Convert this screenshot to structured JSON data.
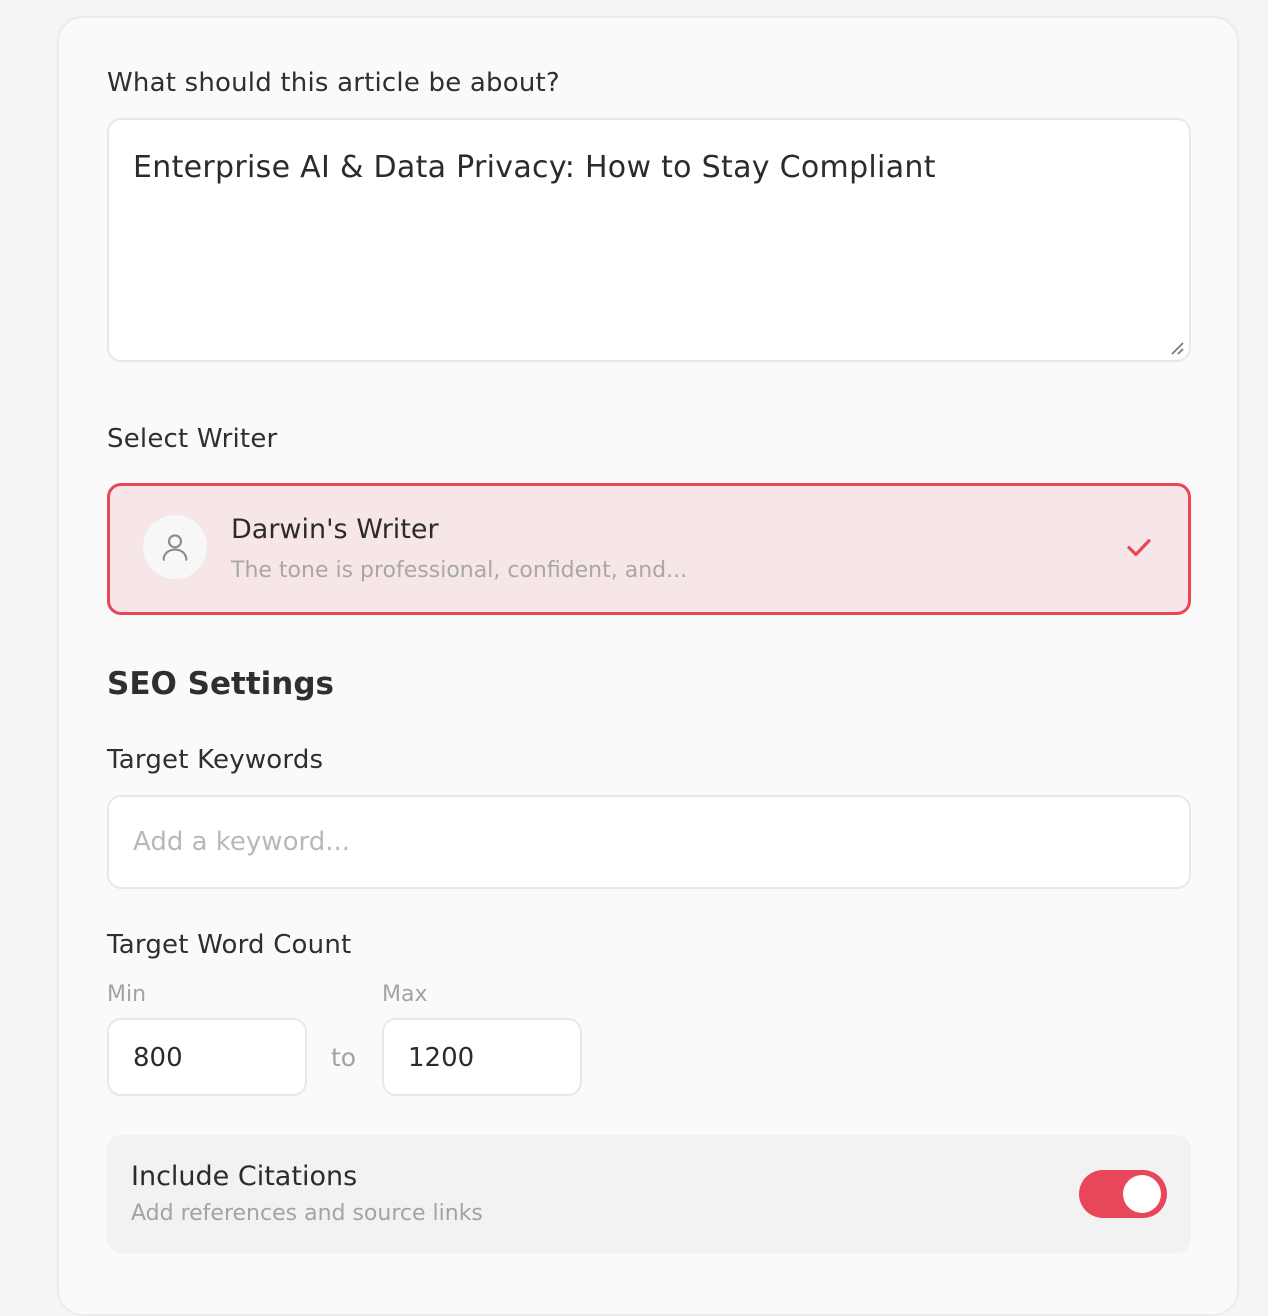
{
  "topic": {
    "label": "What should this article be about?",
    "value": "Enterprise AI & Data Privacy: How to Stay Compliant"
  },
  "writer": {
    "label": "Select Writer",
    "selected": {
      "name": "Darwin's Writer",
      "description": "The tone is professional, confident, and..."
    },
    "icons": {
      "avatar": "user-icon",
      "check": "check-icon"
    },
    "accent_color": "#e8475a",
    "selected_bg": "#f7e6e8"
  },
  "seo": {
    "title": "SEO Settings",
    "keywords": {
      "label": "Target Keywords",
      "placeholder": "Add a keyword..."
    },
    "word_count": {
      "label": "Target Word Count",
      "min_label": "Min",
      "min_value": "800",
      "to_text": "to",
      "max_label": "Max",
      "max_value": "1200"
    },
    "citations": {
      "title": "Include Citations",
      "description": "Add references and source links",
      "enabled": true,
      "toggle_color": "#e8475a"
    }
  }
}
